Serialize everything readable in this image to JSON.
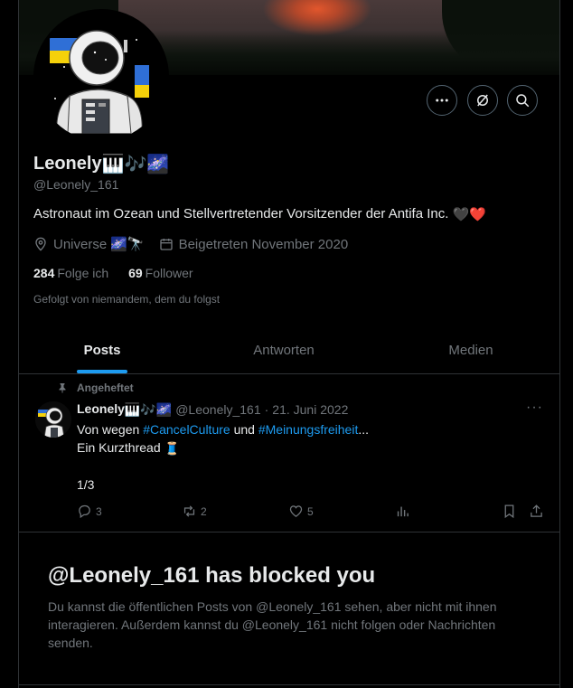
{
  "profile": {
    "name": "Leonely",
    "name_emojis": [
      "🎹",
      "🎶",
      "🌌"
    ],
    "handle": "@Leonely_161",
    "bio": "Astronaut im Ozean und Stellvertretender Vorsitzender der Antifa Inc.",
    "bio_emojis": [
      "🖤",
      "❤️"
    ],
    "location": "Universe",
    "location_emojis": [
      "🌌",
      "🔭"
    ],
    "joined": "Beigetreten November 2020",
    "following_count": "284",
    "following_label": "Folge ich",
    "followers_count": "69",
    "followers_label": "Follower",
    "followed_by": "Gefolgt von niemandem, dem du folgst"
  },
  "header_actions": [
    {
      "icon": "more-icon"
    },
    {
      "icon": "grok-icon"
    },
    {
      "icon": "search-icon"
    }
  ],
  "tabs": [
    {
      "label": "Posts",
      "active": true
    },
    {
      "label": "Antworten",
      "active": false
    },
    {
      "label": "Medien",
      "active": false
    }
  ],
  "post": {
    "pinned_label": "Angeheftet",
    "author_name": "Leonely",
    "author_handle": "@Leonely_161",
    "separator": "·",
    "date": "21. Juni 2022",
    "more": "···",
    "line1_pre": "Von wegen",
    "tag1": "#CancelCulture",
    "line1_mid": "und",
    "tag2": "#Meinungsfreiheit",
    "line1_post": "...",
    "line2": "Ein Kurzthread",
    "line2_emoji": "🧵",
    "line3": "1/3",
    "replies": "3",
    "reposts": "2",
    "likes": "5"
  },
  "blocked": {
    "title": "@Leonely_161 has blocked you",
    "text": "Du kannst die öffentlichen Posts von @Leonely_161 sehen, aber nicht mit ihnen interagieren. Außerdem kannst du @Leonely_161 nicht folgen oder Nachrichten senden."
  },
  "colors": {
    "background": "#000000",
    "text": "#e7e9ea",
    "muted": "#71767b",
    "accent": "#1d9bf0",
    "border": "#2f3336"
  }
}
